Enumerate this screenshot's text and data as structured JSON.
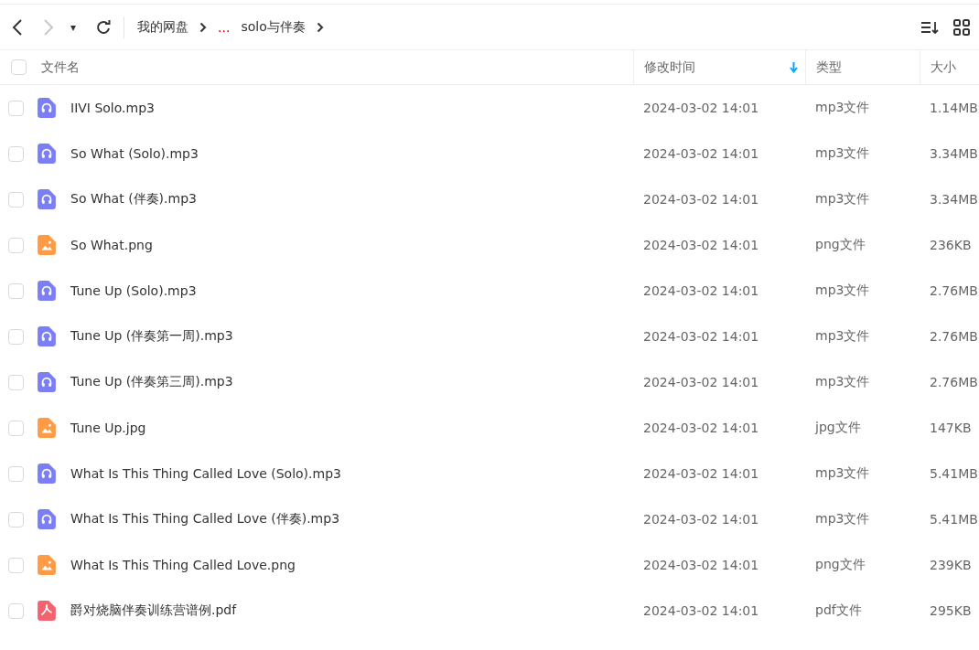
{
  "toolbar": {
    "back": {
      "disabled": false
    },
    "forward": {
      "disabled": true
    },
    "dropdown": "▾",
    "breadcrumb": [
      {
        "label": "我的网盘"
      },
      {
        "label": "..."
      },
      {
        "label": "solo与伴奏"
      }
    ]
  },
  "table": {
    "select_all": {
      "checked": false
    },
    "columns": [
      {
        "label": "文件名",
        "sorted": false
      },
      {
        "label": "修改时间",
        "sorted": true
      },
      {
        "label": "类型",
        "sorted": false
      },
      {
        "label": "大小",
        "sorted": false
      }
    ],
    "rows": [
      {
        "kind": "audio",
        "name": "IIVI Solo.mp3",
        "modified": "2024-03-02 14:01",
        "type": "mp3文件",
        "size": "1.14MB",
        "checked": false
      },
      {
        "kind": "audio",
        "name": "So What (Solo).mp3",
        "modified": "2024-03-02 14:01",
        "type": "mp3文件",
        "size": "3.34MB",
        "checked": false
      },
      {
        "kind": "audio",
        "name": "So What (伴奏).mp3",
        "modified": "2024-03-02 14:01",
        "type": "mp3文件",
        "size": "3.34MB",
        "checked": false
      },
      {
        "kind": "image",
        "name": "So What.png",
        "modified": "2024-03-02 14:01",
        "type": "png文件",
        "size": "236KB",
        "checked": false
      },
      {
        "kind": "audio",
        "name": "Tune Up (Solo).mp3",
        "modified": "2024-03-02 14:01",
        "type": "mp3文件",
        "size": "2.76MB",
        "checked": false
      },
      {
        "kind": "audio",
        "name": "Tune Up (伴奏第一周).mp3",
        "modified": "2024-03-02 14:01",
        "type": "mp3文件",
        "size": "2.76MB",
        "checked": false
      },
      {
        "kind": "audio",
        "name": "Tune Up (伴奏第三周).mp3",
        "modified": "2024-03-02 14:01",
        "type": "mp3文件",
        "size": "2.76MB",
        "checked": false
      },
      {
        "kind": "image",
        "name": "Tune Up.jpg",
        "modified": "2024-03-02 14:01",
        "type": "jpg文件",
        "size": "147KB",
        "checked": false
      },
      {
        "kind": "audio",
        "name": "What Is This Thing Called Love (Solo).mp3",
        "modified": "2024-03-02 14:01",
        "type": "mp3文件",
        "size": "5.41MB",
        "checked": false
      },
      {
        "kind": "audio",
        "name": "What Is This Thing Called Love (伴奏).mp3",
        "modified": "2024-03-02 14:01",
        "type": "mp3文件",
        "size": "5.41MB",
        "checked": false
      },
      {
        "kind": "image",
        "name": "What Is This Thing Called Love.png",
        "modified": "2024-03-02 14:01",
        "type": "png文件",
        "size": "239KB",
        "checked": false
      },
      {
        "kind": "pdf",
        "name": "爵对烧脑伴奏训练营谱例.pdf",
        "modified": "2024-03-02 14:01",
        "type": "pdf文件",
        "size": "295KB",
        "checked": false
      }
    ]
  }
}
